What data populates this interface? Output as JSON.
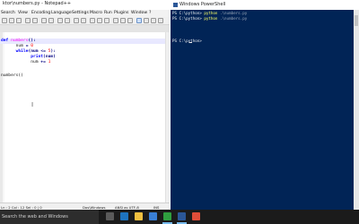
{
  "notepad": {
    "title": "ktor\\numbers.py - Notepad++",
    "menu": [
      "Search",
      "View",
      "Encoding",
      "Language",
      "Settings",
      "Macro",
      "Run",
      "Plugins",
      "Window",
      "?"
    ],
    "code": {
      "line1_kw": "def",
      "line1_fn": "numbers",
      "line1_rest": "():",
      "line2_var": "num",
      "line2_op": "=",
      "line2_num": "0",
      "line3_kw": "while",
      "line3_rest": "(num",
      "line3_op": "<=",
      "line3_num": "5",
      "line3_end": "):",
      "line4_fn": "print",
      "line4_rest": "(num)",
      "line5_var": "num",
      "line5_op": "+=",
      "line5_num": "1",
      "line7": "numbers()"
    },
    "status": {
      "position": "Ln : 2    Col : 12    Sel : 0 | 0",
      "eol": "Dos\\Windows",
      "encoding": "ANSI as UTF-8",
      "mode": "INS"
    }
  },
  "powershell": {
    "title": "Windows PowerShell",
    "lines": [
      {
        "prompt": "PS C:\\python>",
        "cmd": "python",
        "arg": ".\\numbers.py"
      },
      {
        "prompt": "PS C:\\python>",
        "cmd": "python",
        "arg": ".\\numbers.py"
      },
      {
        "prompt": "PS C:\\python>",
        "cmd": "",
        "arg": ""
      }
    ]
  },
  "taskbar": {
    "search_placeholder": "Search the web and Windows"
  },
  "colors": {
    "powershell_bg": "#012456",
    "keyword": "#0000ff",
    "function": "#ff00ff",
    "number": "#ff0000",
    "current_line": "#e8e8ff"
  }
}
